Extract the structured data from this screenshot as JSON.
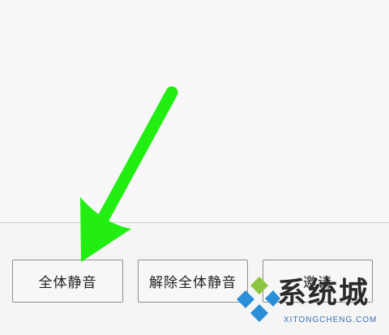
{
  "toolbar": {
    "buttons": [
      {
        "label": "全体静音"
      },
      {
        "label": "解除全体静音"
      },
      {
        "label": "邀请"
      }
    ]
  },
  "annotation": {
    "arrow_color": "#22ee11"
  },
  "watermark": {
    "title": "系统城",
    "subtitle": "XITONGCHENG.COM"
  },
  "colors": {
    "background": "#f7f7f7",
    "button_border": "#8f8f8f",
    "watermark_blue": "#2a8fd8",
    "watermark_green": "#8cc63f"
  }
}
